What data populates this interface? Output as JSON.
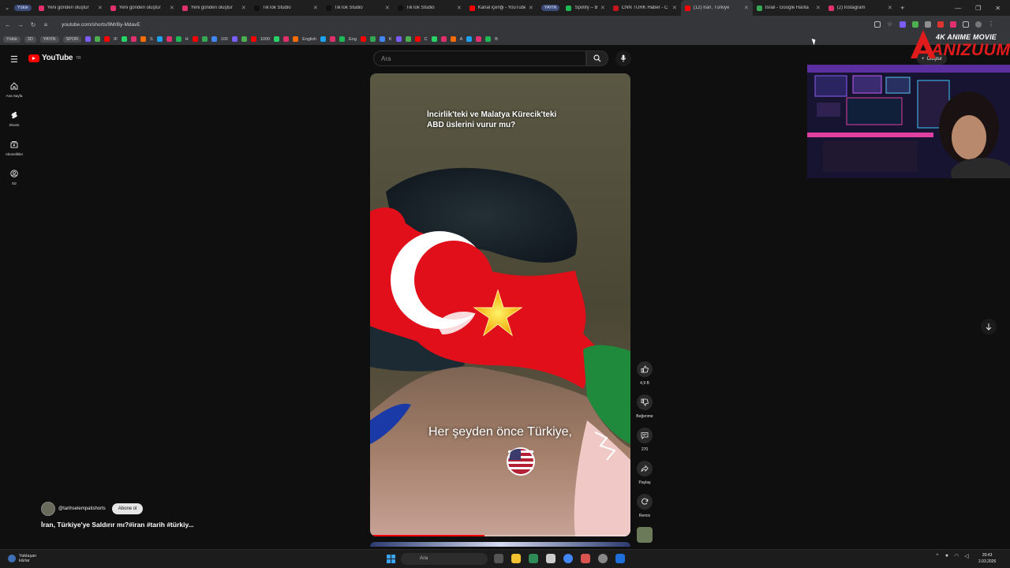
{
  "browser": {
    "tab_pills": [
      "Yükle"
    ],
    "tabs": [
      {
        "label": "Yeni gönderi oluştur",
        "color": "#e1306c"
      },
      {
        "label": "Yeni gönderi oluştur",
        "color": "#e1306c"
      },
      {
        "label": "Yeni gönderi oluştur",
        "color": "#e1306c"
      },
      {
        "label": "TikTok Studio",
        "color": "#111111"
      },
      {
        "label": "TikTok Studio",
        "color": "#111111"
      },
      {
        "label": "TikTok Studio",
        "color": "#111111"
      },
      {
        "label": "Kanal içeriği - YouTube",
        "color": "#ff0000"
      },
      {
        "label": "Spotify – Beğenilen",
        "color": "#1db954",
        "pill": "YAYIN"
      },
      {
        "label": "CNN TÜRK Haber - C",
        "color": "#c4161c"
      },
      {
        "label": "(12) İran, Türkiye",
        "color": "#ff0000",
        "active": true
      },
      {
        "label": "İsrail - Google Harita",
        "color": "#34a853"
      },
      {
        "label": "(2) Instagram",
        "color": "#e1306c"
      }
    ],
    "new_tab": "+",
    "url": "youtube.com/shorts/9MrBy-MdavE",
    "bookmarks": {
      "pills": [
        "Yükle",
        "3D",
        "YAYIN",
        "SPOR"
      ],
      "items": [
        "IF",
        "S",
        "H",
        "100",
        "1000",
        "English",
        "Eng",
        "K",
        "C",
        "A",
        "B"
      ]
    }
  },
  "youtube": {
    "logo_text": "YouTube",
    "logo_region": "TR",
    "search_placeholder": "Ara",
    "create_label": "Oluştur",
    "guide": [
      {
        "label": "Ana Sayfa",
        "icon": "home-icon"
      },
      {
        "label": "Shorts",
        "icon": "shorts-icon"
      },
      {
        "label": "Abonelikler",
        "icon": "subscriptions-icon"
      },
      {
        "label": "Siz",
        "icon": "you-icon"
      }
    ],
    "short": {
      "caption_top_line1": "İncirlik'teki ve Malatya Kürecik'teki",
      "caption_top_line2": "ABD üslerini vurur mu?",
      "subtitle": "Her şeyden önce Türkiye,",
      "progress": 0.44
    },
    "actions": {
      "likes": "4,9 B",
      "dislike_label": "Beğenme",
      "comments": "270",
      "share_label": "Paylaş",
      "remix_label": "Remix"
    },
    "channel": {
      "handle": "@tarihselempatishorts",
      "subscribe_label": "Abone ol"
    },
    "video_title": "İran, Türkiye'ye Saldırır mı?#iran  #tarih  #türkiy..."
  },
  "overlay": {
    "brand_line1": "4K ANIME MOVIE",
    "brand_line2": "ANIZUUM"
  },
  "taskbar": {
    "weather_line1": "Yaklaşan",
    "weather_line2": "kârlar",
    "search_placeholder": "Ara",
    "time": "20:43",
    "date": "2.03.2026"
  },
  "colors": {
    "yt_red": "#ff0000",
    "bg": "#0f0f0f"
  }
}
